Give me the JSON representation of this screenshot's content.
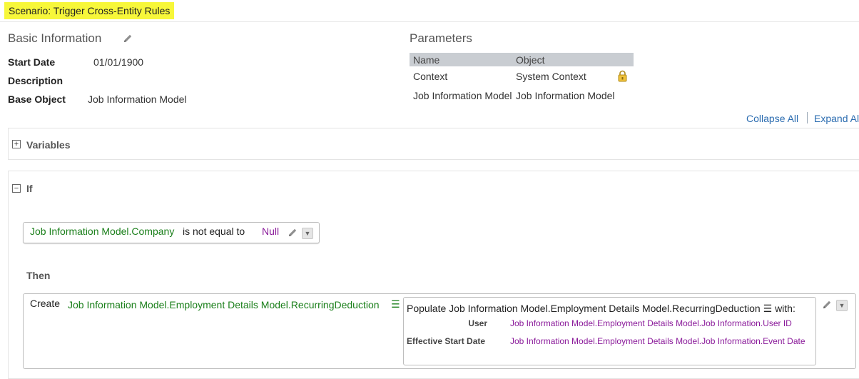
{
  "scenario_title": "Scenario: Trigger Cross-Entity Rules",
  "basic_info": {
    "title": "Basic Information",
    "start_date_label": "Start Date",
    "start_date_value": "01/01/1900",
    "description_label": "Description",
    "base_object_label": "Base Object",
    "base_object_value": "Job Information Model"
  },
  "parameters": {
    "title": "Parameters",
    "columns": [
      "Name",
      "Object"
    ],
    "rows": [
      {
        "name": "Context",
        "object": "System Context",
        "locked": true
      },
      {
        "name": "Job Information Model",
        "object": "Job Information Model",
        "locked": false
      }
    ]
  },
  "links": {
    "collapse_all": "Collapse All",
    "expand_all": "Expand All"
  },
  "variables": {
    "toggle": "+",
    "label": "Variables"
  },
  "if_section": {
    "toggle": "−",
    "label": "If",
    "condition": {
      "field": "Job Information Model.Company",
      "operator": "is not equal to",
      "value": "Null"
    }
  },
  "then_section": {
    "label": "Then",
    "action": "Create",
    "target": "Job Information Model.Employment Details Model.RecurringDeduction",
    "target_menu_glyph": "☰",
    "populate": {
      "prefix": "Populate",
      "target": "Job Information Model.Employment Details Model.RecurringDeduction",
      "menu_glyph": "☰",
      "suffix": "with:",
      "rows": [
        {
          "label": "User",
          "value": "Job Information Model.Employment Details Model.Job Information.User ID"
        },
        {
          "label": "Effective Start Date",
          "value": "Job Information Model.Employment Details Model.Job Information.Event Date"
        }
      ]
    }
  },
  "icons": {
    "edit": "pencil-icon",
    "lock": "lock-icon",
    "dropdown": "dropdown-icon",
    "expand": "plus-box-icon",
    "collapse": "minus-box-icon"
  },
  "colors": {
    "highlight": "#f7f73a",
    "link": "#2b6cb0",
    "field_green": "#1a7f1a",
    "value_purple": "#8a1a9a",
    "table_header": "#c9cdd2"
  }
}
